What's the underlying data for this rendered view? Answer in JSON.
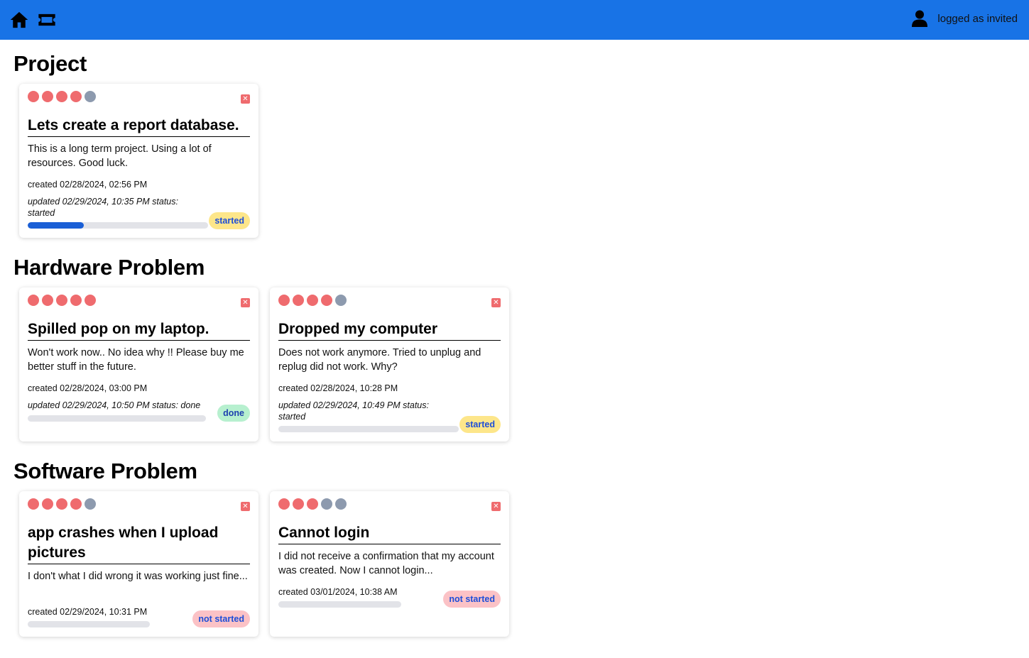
{
  "header": {
    "home_icon": "home-icon",
    "ticket_icon": "ticket-icon",
    "user_icon": "user-icon",
    "user_text": "logged as invited",
    "background": "#1873e6"
  },
  "sections": [
    {
      "title": "Project",
      "cards": [
        {
          "rating": 4,
          "title": "Lets create a report database.",
          "description": "This is a long term project. Using a lot of resources. Good luck.",
          "created": "created 02/28/2024, 02:56 PM",
          "updated": "updated 02/29/2024, 10:35 PM status: started",
          "status": "started",
          "progress": 0.31
        }
      ]
    },
    {
      "title": "Hardware Problem",
      "cards": [
        {
          "rating": 5,
          "title": "Spilled pop on my laptop.",
          "description": "Won't work now.. No idea why !! Please buy me better stuff in the future.",
          "created": "created 02/28/2024, 03:00 PM",
          "updated": "updated 02/29/2024, 10:50 PM status: done",
          "status": "done",
          "progress": 0
        },
        {
          "rating": 4,
          "title": "Dropped my computer",
          "description": "Does not work anymore. Tried to unplug and replug did not work. Why?",
          "created": "created 02/28/2024, 10:28 PM",
          "updated": "updated 02/29/2024, 10:49 PM status: started",
          "status": "started",
          "progress": 0
        }
      ]
    },
    {
      "title": "Software Problem",
      "cards": [
        {
          "rating": 4,
          "title": "app crashes when I upload pictures",
          "description": "I don't what I did wrong it was working just fine...",
          "created": "created 02/29/2024, 10:31 PM",
          "status": "not started",
          "progress": 0
        },
        {
          "rating": 3,
          "title": "Cannot login",
          "description": "I did not receive a confirmation that my account was created. Now I cannot login...",
          "created": "created 03/01/2024, 10:38 AM",
          "status": "not started",
          "progress": 0
        }
      ]
    }
  ],
  "colors": {
    "rating_on": "#ef6b6e",
    "rating_off": "#8d9aae",
    "progress_fill": "#1a5fd6",
    "badge_started": "#fde68a",
    "badge_done": "#b7f0cf",
    "badge_not_started": "#fbc2c6"
  }
}
